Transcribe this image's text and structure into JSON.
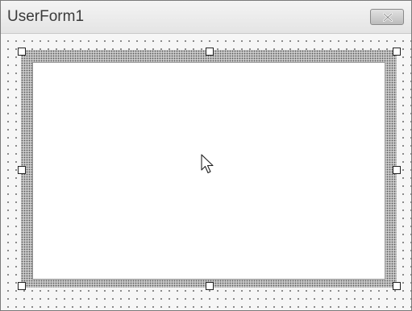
{
  "window": {
    "title": "UserForm1",
    "close_icon": "close-icon"
  },
  "designer": {
    "selected_control": "frame",
    "handles": [
      "top-left",
      "top-center",
      "top-right",
      "middle-left",
      "middle-right",
      "bottom-left",
      "bottom-center",
      "bottom-right"
    ],
    "cursor_icon": "arrow-pointer-icon"
  }
}
